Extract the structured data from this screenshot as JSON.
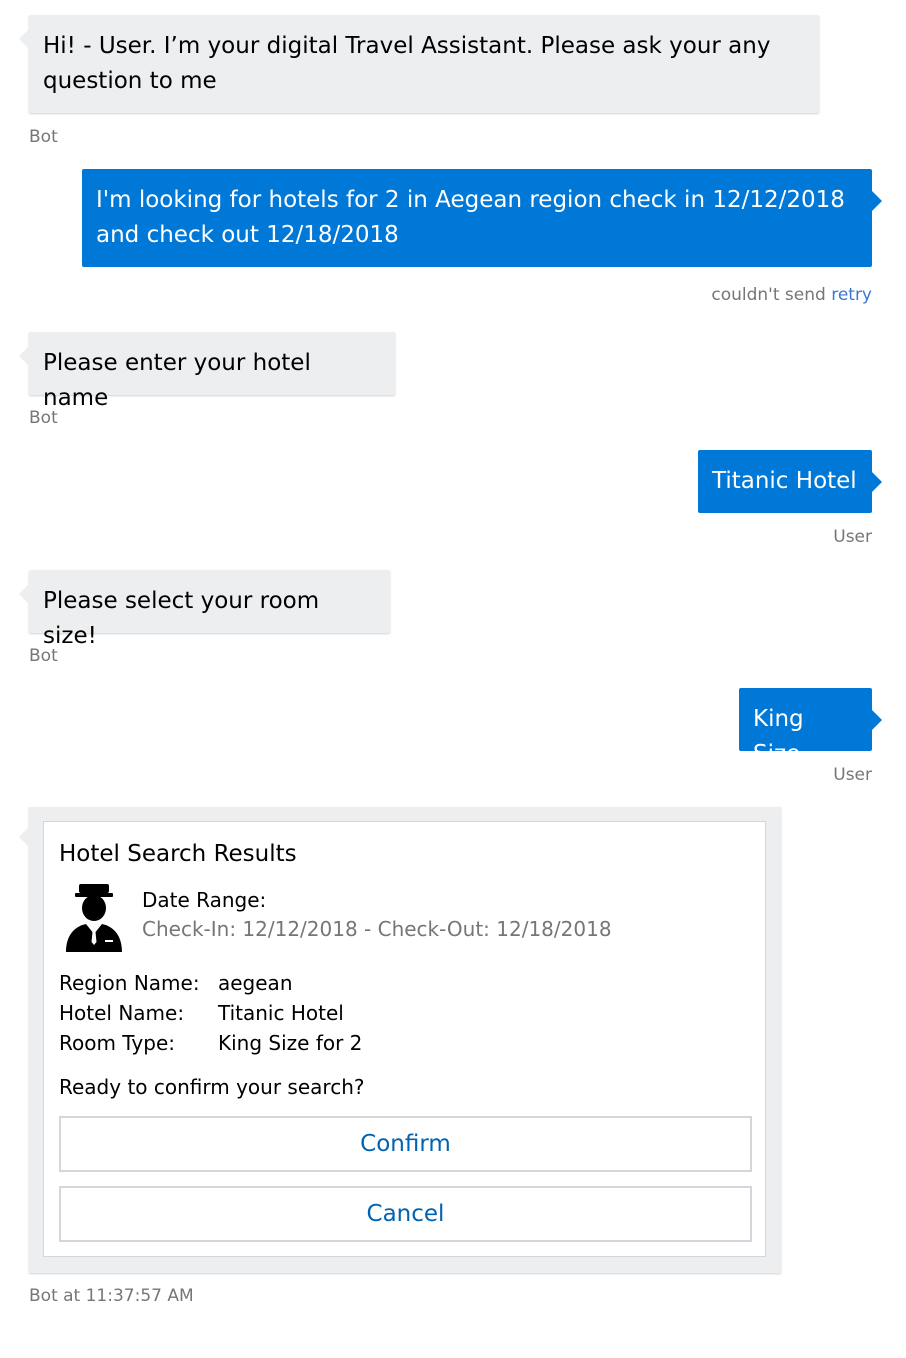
{
  "messages": [
    {
      "from": "bot",
      "text": "Hi! - User. I’m your digital Travel Assistant. Please ask your any\nquestion to me",
      "meta": "Bot"
    },
    {
      "from": "user",
      "text": "I'm looking for hotels for 2 in Aegean region check in 12/12/2018\nand check out 12/18/2018",
      "status": "couldn't send",
      "retry_label": "retry"
    },
    {
      "from": "bot",
      "text": "Please enter your hotel name",
      "meta": "Bot"
    },
    {
      "from": "user",
      "text": "Titanic Hotel",
      "meta": "User"
    },
    {
      "from": "bot",
      "text": "Please select your room size!",
      "meta": "Bot"
    },
    {
      "from": "user",
      "text": "King Size",
      "meta": "User"
    }
  ],
  "card": {
    "title": "Hotel Search Results",
    "avatar_icon": "bellhop-icon",
    "date_label": "Date Range:",
    "date_value": "Check-In: 12/12/2018 - Check-Out: 12/18/2018",
    "facts": [
      {
        "label": "Region Name:",
        "value": "aegean"
      },
      {
        "label": "Hotel Name:",
        "value": "Titanic Hotel"
      },
      {
        "label": "Room Type:",
        "value": "King Size for 2"
      }
    ],
    "prompt": "Ready to confirm your search?",
    "confirm_label": "Confirm",
    "cancel_label": "Cancel",
    "meta": "Bot at 11:37:57 AM"
  },
  "colors": {
    "user_bubble": "#0078d7",
    "bot_bubble": "#eceef0",
    "action_text": "#0063b1"
  }
}
